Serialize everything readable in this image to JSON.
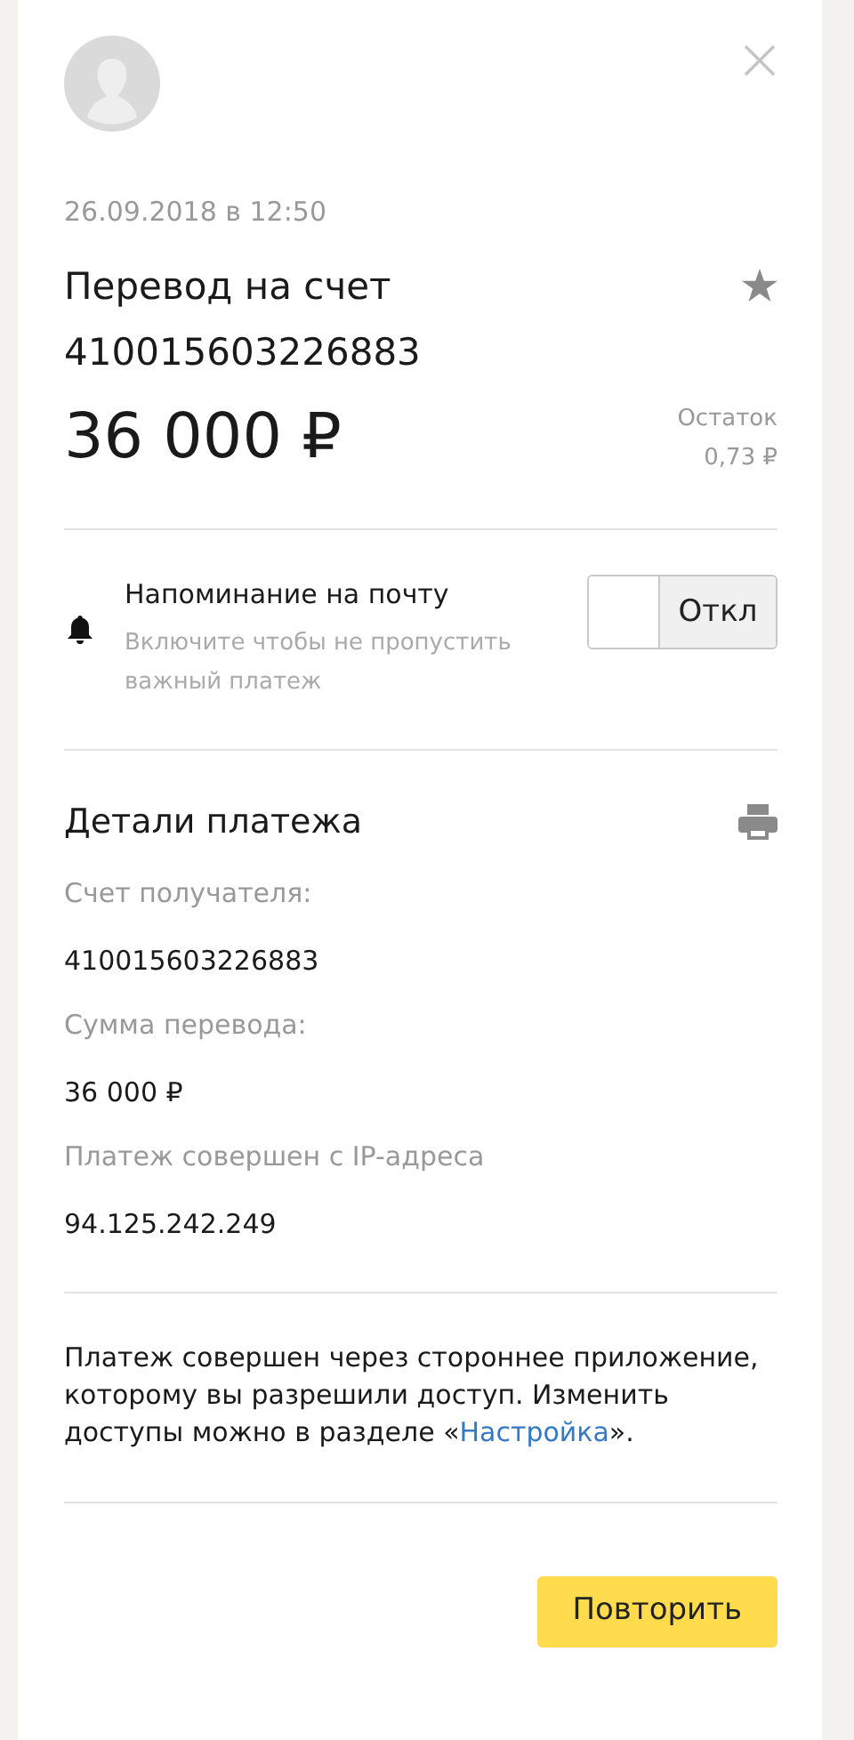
{
  "date": "26.09.2018 в 12:50",
  "title_lines": [
    "Перевод на счет",
    "410015603226883"
  ],
  "amount": "36 000 ₽",
  "balance": {
    "label": "Остаток",
    "value": "0,73 ₽"
  },
  "reminder": {
    "title": "Напоминание на почту",
    "hint": "Включите чтобы не пропустить важный платеж",
    "on": false,
    "state_label": "Откл"
  },
  "details": {
    "heading": "Детали платежа",
    "fields": [
      {
        "label": "Счет получателя:",
        "value": "410015603226883"
      },
      {
        "label": "Сумма перевода:",
        "value": "36 000 ₽"
      },
      {
        "label": "Платеж совершен с IP-адреса",
        "value": "94.125.242.249"
      }
    ]
  },
  "note": {
    "before": "Платеж совершен через стороннее приложение, которому вы разрешили доступ. Изменить доступы можно в разделе «",
    "link": "Настройка",
    "after": "»."
  },
  "repeat_button": "Повторить"
}
